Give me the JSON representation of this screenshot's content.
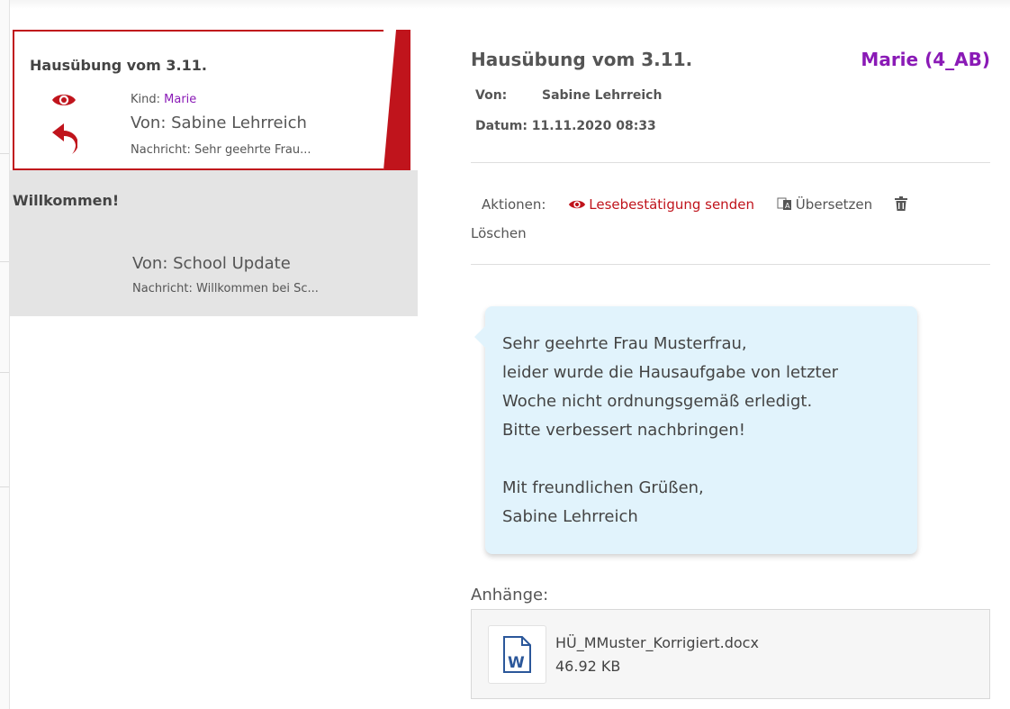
{
  "list": {
    "items": [
      {
        "title": "Hausübung vom 3.11.",
        "kind_label": "Kind: ",
        "kind_value": "Marie",
        "from": "Von: Sabine Lehrreich",
        "message": "Nachricht: Sehr geehrte Frau..."
      },
      {
        "title": "Willkommen!",
        "from": "Von: School Update",
        "message": "Nachricht: Willkommen bei Sc..."
      }
    ]
  },
  "detail": {
    "title": "Hausübung vom 3.11.",
    "child": "Marie (4_AB)",
    "from_label": "Von:",
    "from_value": "Sabine Lehrreich",
    "date_label": "Datum:",
    "date_value": "11.11.2020 08:33",
    "actions": {
      "label": "Aktionen:",
      "read_receipt": "Lesebestätigung senden",
      "translate": "Übersetzen",
      "delete": "Löschen"
    },
    "message_lines": [
      "Sehr geehrte Frau Musterfrau,",
      "leider wurde die Hausaufgabe von letzter",
      "Woche nicht ordnungsgemäß erledigt.",
      "Bitte verbessert nachbringen!",
      "",
      "Mit freundlichen Grüßen,",
      "Sabine Lehrreich"
    ],
    "attachments_label": "Anhänge:",
    "attachment": {
      "name": "HÜ_MMuster_Korrigiert.docx",
      "size": "46.92 KB"
    }
  },
  "colors": {
    "accent_red": "#c0141c",
    "child_purple": "#8a1ab6",
    "bubble_blue": "#e1f3fc",
    "list_gray": "#e4e4e4"
  },
  "icons": [
    "eye-icon",
    "reply-icon",
    "translate-icon",
    "trash-icon",
    "word-document-icon"
  ]
}
